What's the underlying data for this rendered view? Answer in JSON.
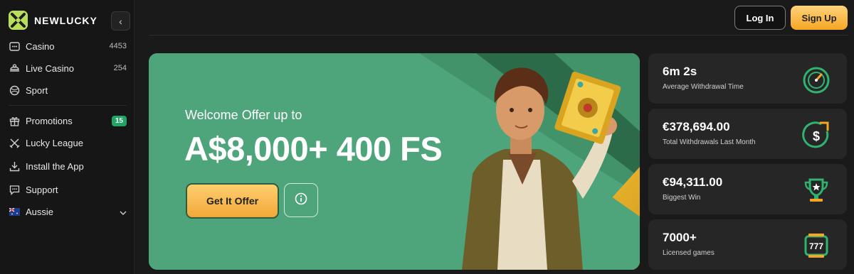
{
  "brand": {
    "name": "NEWLUCKY"
  },
  "sidebar": {
    "items": [
      {
        "label": "Casino",
        "count": "4453",
        "icon": "slot-machine-icon"
      },
      {
        "label": "Live Casino",
        "count": "254",
        "icon": "live-dealer-icon"
      },
      {
        "label": "Sport",
        "icon": "sports-ball-icon"
      },
      {
        "label": "Promotions",
        "badge": "15",
        "icon": "gift-icon"
      },
      {
        "label": "Lucky League",
        "icon": "crossed-swords-icon"
      },
      {
        "label": "Install the App",
        "icon": "download-icon"
      },
      {
        "label": "Support",
        "icon": "chat-icon"
      },
      {
        "label": "Aussie",
        "icon": "australia-flag-icon"
      }
    ]
  },
  "header": {
    "login_label": "Log In",
    "signup_label": "Sign Up"
  },
  "banner": {
    "welcome": "Welcome Offer up to",
    "headline": "A$8,000+ 400 FS",
    "cta_label": "Get It Offer"
  },
  "stats": [
    {
      "value": "6m 2s",
      "label": "Average Withdrawal Time",
      "icon": "stopwatch-icon"
    },
    {
      "value": "€378,694.00",
      "label": "Total Withdrawals Last Month",
      "icon": "dollar-up-icon"
    },
    {
      "value": "€94,311.00",
      "label": "Biggest Win",
      "icon": "trophy-icon"
    },
    {
      "value": "7000+",
      "label": "Licensed games",
      "icon": "slot-777-icon"
    }
  ],
  "colors": {
    "accent_green": "#2fb36f",
    "gold": "#f5a623",
    "banner_green": "#4fa57b"
  }
}
